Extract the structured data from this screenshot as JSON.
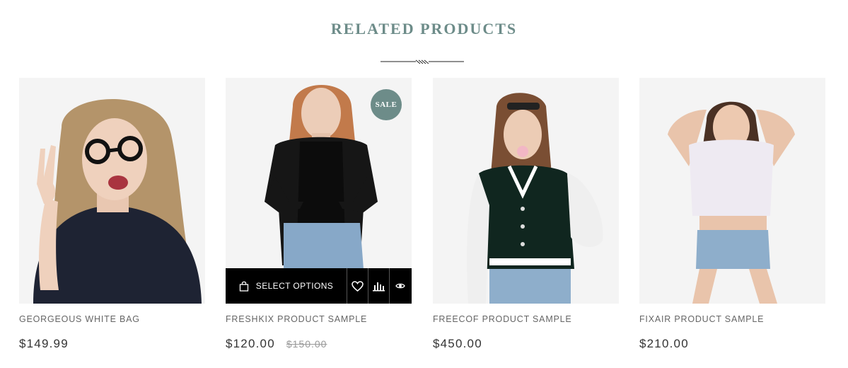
{
  "section": {
    "title": "RELATED PRODUCTS"
  },
  "colors": {
    "accent": "#6d8c89",
    "action_bar": "#000000",
    "image_bg": "#f4f4f4"
  },
  "products": [
    {
      "name": "GEORGEOUS WHITE BAG",
      "price": "$149.99",
      "old_price": "",
      "on_sale": false
    },
    {
      "name": "FRESHKIX PRODUCT SAMPLE",
      "price": "$120.00",
      "old_price": "$150.00",
      "on_sale": true,
      "badge": "SALE",
      "hovered": true,
      "actions": {
        "select_label": "SELECT OPTIONS",
        "icons": [
          "bag-icon",
          "heart-icon",
          "compare-icon",
          "eye-icon"
        ]
      }
    },
    {
      "name": "FREECOF PRODUCT SAMPLE",
      "price": "$450.00",
      "old_price": "",
      "on_sale": false
    },
    {
      "name": "FIXAIR PRODUCT SAMPLE",
      "price": "$210.00",
      "old_price": "",
      "on_sale": false
    }
  ]
}
